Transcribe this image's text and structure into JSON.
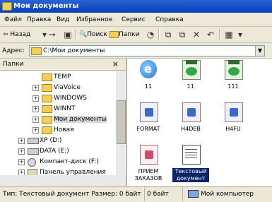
{
  "window": {
    "title": "Мои документы"
  },
  "menu": [
    "Файл",
    "Правка",
    "Вид",
    "Избранное",
    "Сервис",
    "Справка"
  ],
  "toolbar": {
    "back": "Назад",
    "search": "Поиск",
    "folders": "Папки"
  },
  "address": {
    "label": "Адрес:",
    "value": "C:\\Мои документы"
  },
  "folders_pane": {
    "title": "Папки",
    "tree": [
      {
        "label": "TEMP"
      },
      {
        "label": "ViaVoice"
      },
      {
        "label": "WINDOWS"
      },
      {
        "label": "WINNT"
      },
      {
        "label": "Мои документы",
        "selected": true
      },
      {
        "label": "Новая"
      },
      {
        "label": "XP (D:)"
      },
      {
        "label": "DATA (E:)"
      },
      {
        "label": "Компакт-диск (F:)"
      },
      {
        "label": "Панель управления"
      }
    ]
  },
  "files": [
    {
      "name": "11",
      "icon": "ie-icon"
    },
    {
      "name": "11",
      "icon": "jpg-icon"
    },
    {
      "name": "111",
      "icon": "jpg-icon"
    },
    {
      "name": "FORMAT",
      "icon": "doc-icon"
    },
    {
      "name": "H4DEB",
      "icon": "doc-icon"
    },
    {
      "name": "H4FU",
      "icon": "doc-icon"
    },
    {
      "name": "ПРИЕМ ЗАКАЗОВ",
      "icon": "order-icon"
    },
    {
      "name": "Текстовый документ",
      "icon": "text-doc-icon",
      "selected": true
    }
  ],
  "status": {
    "type": "Тип: Текстовый документ Размер: 0 байт",
    "size": "0 байт",
    "location": "Мой компьютер"
  }
}
